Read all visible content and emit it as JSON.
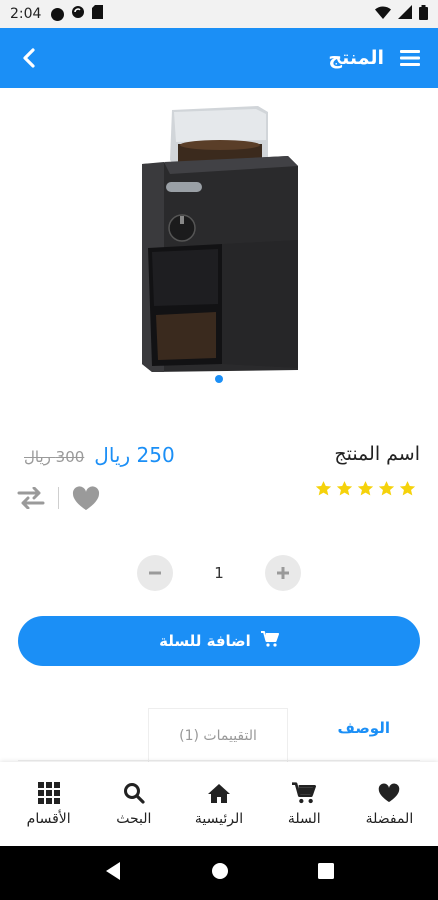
{
  "status_bar": {
    "time": "2:04"
  },
  "app_bar": {
    "title": "المنتج"
  },
  "product": {
    "name": "اسم المنتج",
    "price_new": "250 ريال",
    "price_old": "300 ريال",
    "rating": 5,
    "quantity": "1"
  },
  "buttons": {
    "add_to_cart": "اضافة للسلة"
  },
  "tabs": {
    "description": "الوصف",
    "reviews": "التقييمات (1)"
  },
  "bottom_nav": [
    {
      "label": "المفضلة",
      "icon": "heart-icon"
    },
    {
      "label": "السلة",
      "icon": "cart-icon"
    },
    {
      "label": "الرئيسية",
      "icon": "home-icon"
    },
    {
      "label": "البحث",
      "icon": "search-icon"
    },
    {
      "label": "الأقسام",
      "icon": "grid-icon"
    }
  ],
  "colors": {
    "primary": "#1b8ff6",
    "star": "#f5d20b",
    "muted": "#9a9a9a"
  }
}
